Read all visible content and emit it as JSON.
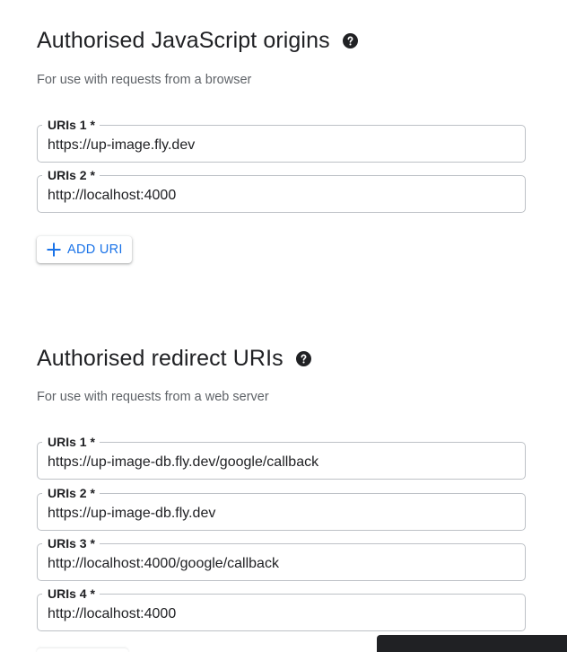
{
  "js_origins": {
    "title": "Authorised JavaScript origins",
    "description": "For use with requests from a browser",
    "fields": [
      {
        "label": "URIs 1 *",
        "value": "https://up-image.fly.dev"
      },
      {
        "label": "URIs 2 *",
        "value": "http://localhost:4000"
      }
    ],
    "add_button_label": "ADD URI"
  },
  "redirect_uris": {
    "title": "Authorised redirect URIs",
    "description": "For use with requests from a web server",
    "fields": [
      {
        "label": "URIs 1 *",
        "value": "https://up-image-db.fly.dev/google/callback"
      },
      {
        "label": "URIs 2 *",
        "value": "https://up-image-db.fly.dev"
      },
      {
        "label": "URIs 3 *",
        "value": "http://localhost:4000/google/callback"
      },
      {
        "label": "URIs 4 *",
        "value": "http://localhost:4000"
      }
    ]
  },
  "icons": {
    "help": "help-circle-icon",
    "add": "plus-icon"
  },
  "colors": {
    "accent": "#1a73e8",
    "text": "#202124",
    "secondary_text": "#5f6368",
    "field_border": "#bdc1c6",
    "snackbar": "#202124"
  }
}
